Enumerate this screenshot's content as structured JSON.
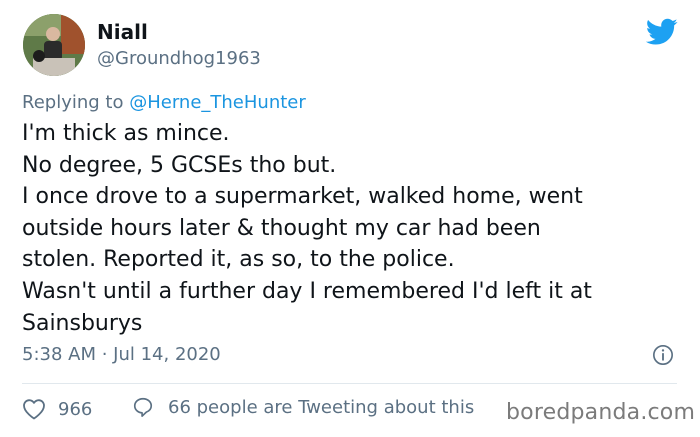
{
  "tweet": {
    "author_name": "Niall",
    "author_handle": "@Groundhog1963",
    "replying_prefix": "Replying to",
    "replying_handle": "@Herne_TheHunter",
    "lines": [
      "I'm thick as mince.",
      "No degree, 5 GCSEs tho but.",
      "I once drove to a supermarket, walked home, went",
      "outside hours later & thought my car had been",
      "stolen. Reported it, as so, to the police.",
      "Wasn't until a further day I remembered I'd left it at",
      "Sainsburys"
    ],
    "timestamp": "5:38 AM · Jul 14, 2020",
    "like_count": "966",
    "conversation_text": "66 people are Tweeting about this"
  },
  "watermark": "boredpanda.com",
  "colors": {
    "text": "#0f1419",
    "secondary": "#5b7083",
    "link": "#1b95e0",
    "twitter_blue": "#1da1f2",
    "divider": "#e1e8ed"
  },
  "icons": {
    "brand": "twitter-bird-icon",
    "info": "info-icon",
    "like": "heart-icon",
    "reply": "speech-bubble-icon"
  }
}
